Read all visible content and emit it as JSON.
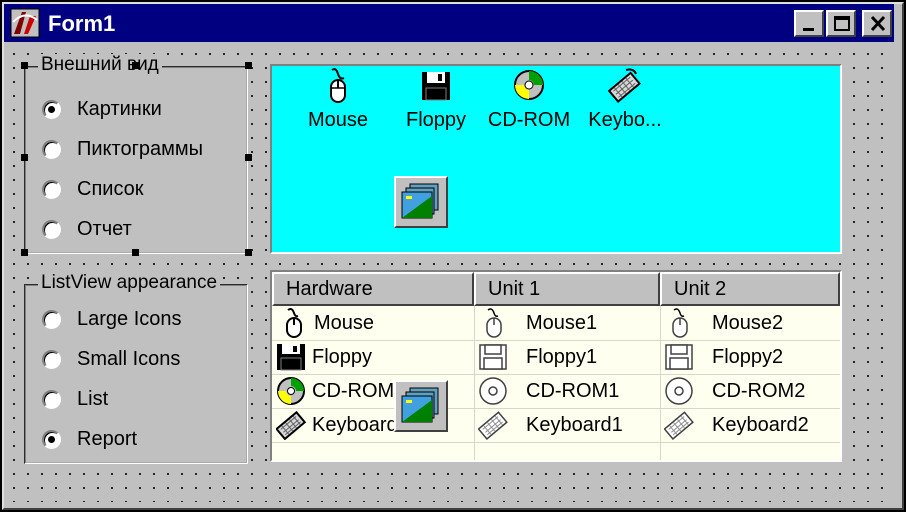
{
  "window": {
    "title": "Form1",
    "controls": [
      "minimize",
      "maximize",
      "close"
    ]
  },
  "group_ru": {
    "caption": "Внешний вид",
    "options": [
      {
        "label": "Картинки",
        "checked": true
      },
      {
        "label": "Пиктограммы",
        "checked": false
      },
      {
        "label": "Список",
        "checked": false
      },
      {
        "label": "Отчет",
        "checked": false
      }
    ]
  },
  "group_en": {
    "caption": "ListView appearance",
    "options": [
      {
        "label": "Large Icons",
        "checked": false
      },
      {
        "label": "Small Icons",
        "checked": false
      },
      {
        "label": "List",
        "checked": false
      },
      {
        "label": "Report",
        "checked": true
      }
    ]
  },
  "listview_icons": {
    "background": "#00ffff",
    "items": [
      {
        "label": "Mouse",
        "icon": "mouse-icon"
      },
      {
        "label": "Floppy",
        "icon": "floppy-icon"
      },
      {
        "label": "CD-ROM",
        "icon": "cdrom-icon"
      },
      {
        "label": "Keybo...",
        "icon": "keyboard-icon"
      }
    ]
  },
  "listview_report": {
    "background": "#fffff0",
    "columns": [
      "Hardware",
      "Unit 1",
      "Unit 2"
    ],
    "rows": [
      {
        "hardware": "Mouse",
        "unit1": "Mouse1",
        "unit2": "Mouse2",
        "icon": "mouse-icon"
      },
      {
        "hardware": "Floppy",
        "unit1": "Floppy1",
        "unit2": "Floppy2",
        "icon": "floppy-icon"
      },
      {
        "hardware": "CD-ROM",
        "unit1": "CD-ROM1",
        "unit2": "CD-ROM2",
        "icon": "cdrom-icon"
      },
      {
        "hardware": "Keyboard",
        "unit1": "Keyboard1",
        "unit2": "Keyboard2",
        "icon": "keyboard-icon"
      }
    ]
  },
  "colors": {
    "titlebar": "#000080",
    "face": "#c0c0c0"
  }
}
